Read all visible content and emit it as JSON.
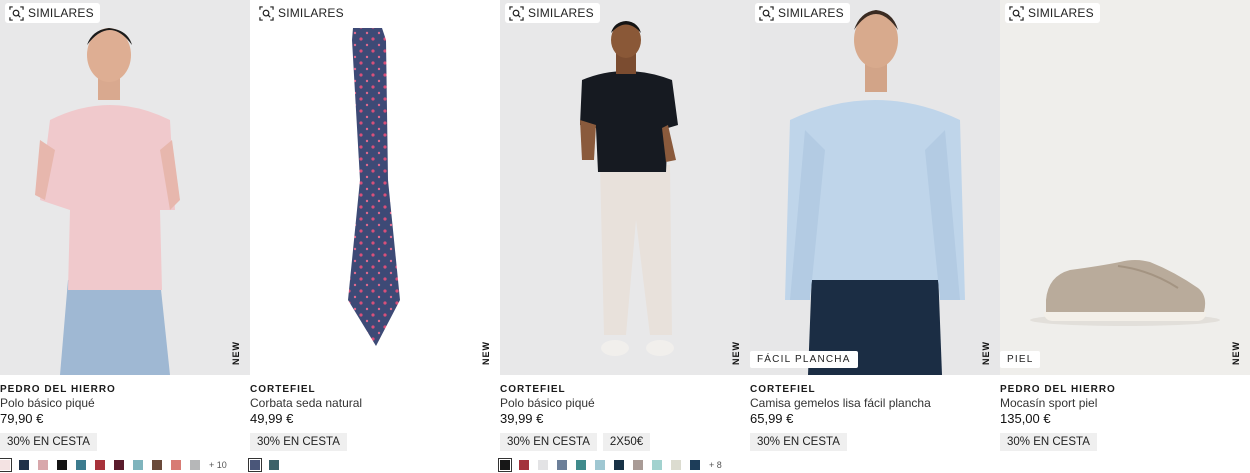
{
  "common": {
    "similar_label": "SIMILARES",
    "new_label": "NEW"
  },
  "products": [
    {
      "brand": "PEDRO DEL HIERRO",
      "name": "Polo básico piqué",
      "price": "79,90 €",
      "promos": [
        "30% EN CESTA"
      ],
      "tag": "",
      "swatches": [
        "#f4e3e3",
        "#1f3148",
        "#d8a7ab",
        "#141414",
        "#3c7b8e",
        "#a8323b",
        "#5a1c2c",
        "#7fb4bd",
        "#6a4a3a",
        "#d87b74",
        "#b6b7b8"
      ],
      "more": "+ 10"
    },
    {
      "brand": "CORTEFIEL",
      "name": "Corbata seda natural",
      "price": "49,99 €",
      "promos": [
        "30% EN CESTA"
      ],
      "tag": "",
      "swatches": [
        "#4a5679",
        "#3b6168"
      ],
      "more": ""
    },
    {
      "brand": "CORTEFIEL",
      "name": "Polo básico piqué",
      "price": "39,99 €",
      "promos": [
        "30% EN CESTA",
        "2X50€"
      ],
      "tag": "",
      "swatches": [
        "#171717",
        "#a3323b",
        "#e3e3e5",
        "#6c7f99",
        "#3f8b8c",
        "#9fc7d2",
        "#183246",
        "#a99b96",
        "#a2d2cf",
        "#dcdcd0",
        "#1d3d59"
      ],
      "more": "+ 8"
    },
    {
      "brand": "CORTEFIEL",
      "name": "Camisa gemelos lisa fácil plancha",
      "price": "65,99 €",
      "promos": [
        "30% EN CESTA"
      ],
      "tag": "FÁCIL PLANCHA",
      "swatches": [],
      "more": ""
    },
    {
      "brand": "PEDRO DEL HIERRO",
      "name": "Mocasín sport piel",
      "price": "135,00 €",
      "promos": [
        "30% EN CESTA"
      ],
      "tag": "PIEL",
      "swatches": [],
      "more": ""
    }
  ]
}
